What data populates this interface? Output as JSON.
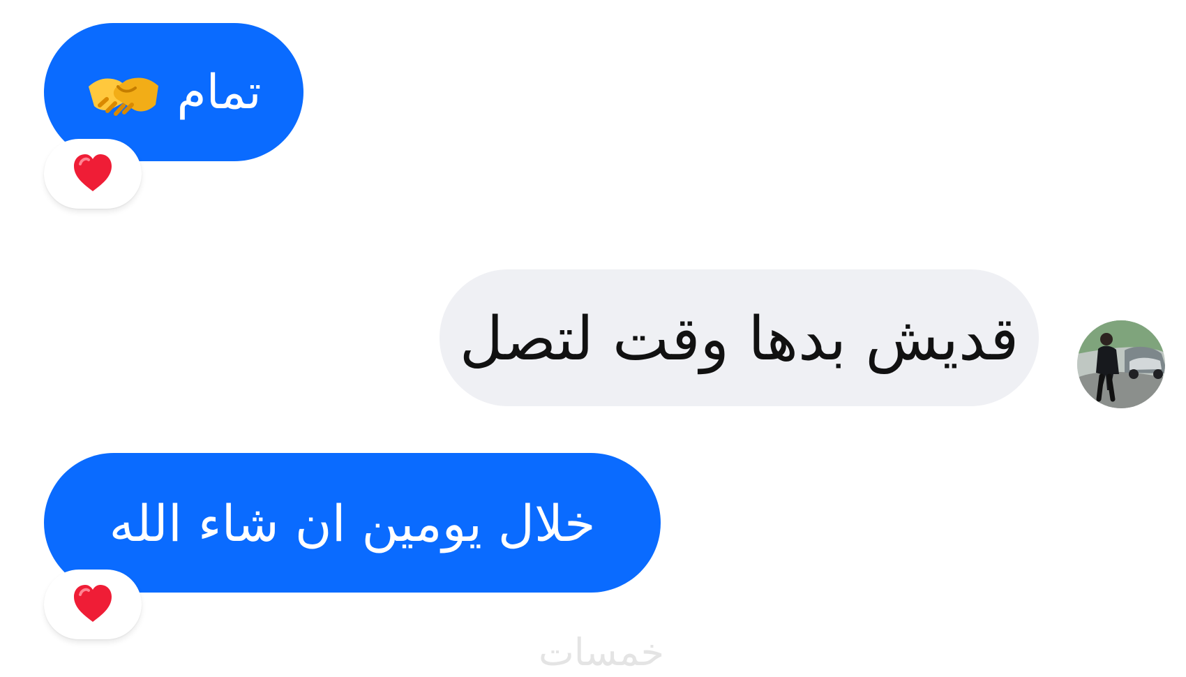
{
  "messages": [
    {
      "id": "msg-1",
      "direction": "outgoing",
      "text": "تمام",
      "emoji": "handshake-emoji",
      "reaction": "red-heart-icon"
    },
    {
      "id": "msg-2",
      "direction": "incoming",
      "text": "قديش بدها وقت لتصل",
      "sender_avatar": "avatar"
    },
    {
      "id": "msg-3",
      "direction": "outgoing",
      "text": "خلال يومين ان شاء الله",
      "reaction": "red-heart-icon"
    }
  ],
  "watermark": "خمسات",
  "colors": {
    "outgoing_bubble": "#0a6bff",
    "incoming_bubble": "#eff0f4",
    "outgoing_text": "#ffffff",
    "incoming_text": "#111111",
    "reaction_heart": "#ef1d36",
    "watermark": "#e4e4e4"
  }
}
